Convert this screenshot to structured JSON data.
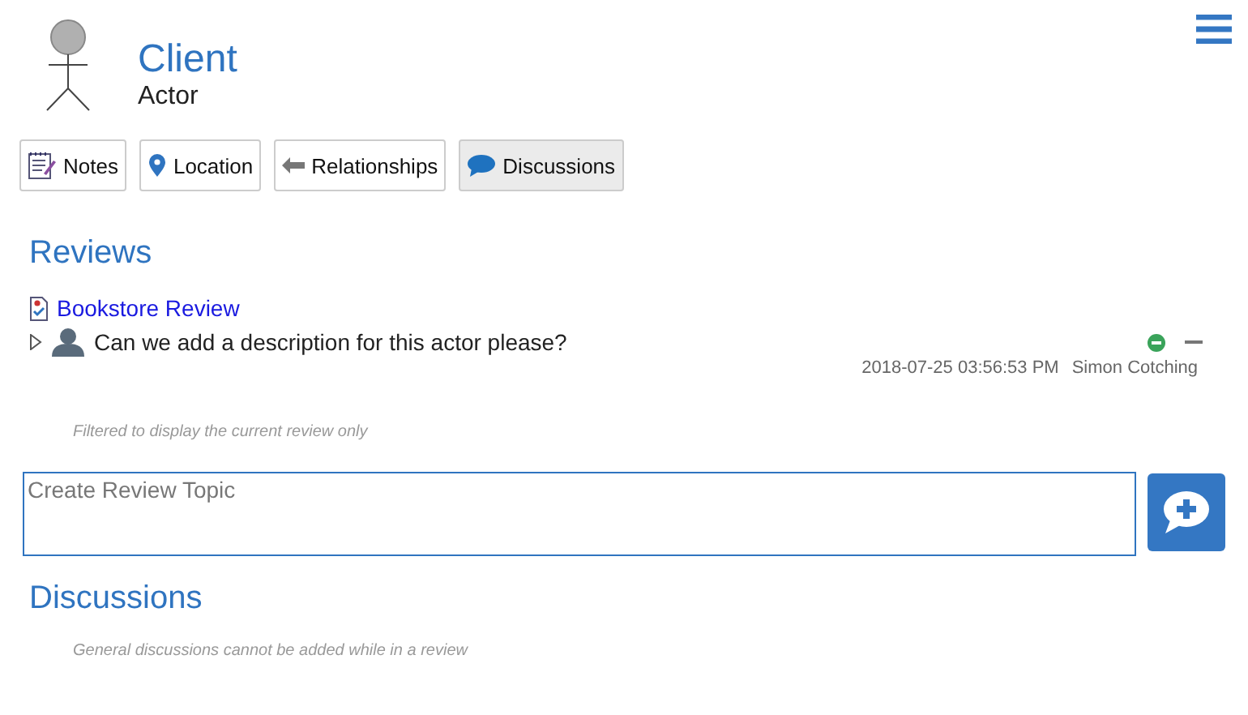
{
  "header": {
    "title": "Client",
    "subtitle": "Actor"
  },
  "tabs": [
    {
      "label": "Notes",
      "kind": "notes",
      "selected": false
    },
    {
      "label": "Location",
      "kind": "location",
      "selected": false
    },
    {
      "label": "Relationships",
      "kind": "relationships",
      "selected": false
    },
    {
      "label": "Discussions",
      "kind": "discussions",
      "selected": true
    }
  ],
  "reviews": {
    "heading": "Reviews",
    "review_link": "Bookstore Review",
    "topics": [
      {
        "text": "Can we add a description for this actor please?",
        "timestamp": "2018-07-25 03:56:53 PM",
        "author": "Simon Cotching",
        "expanded": false
      }
    ],
    "filter_note": "Filtered to display the current review only",
    "input": {
      "placeholder": "Create Review Topic"
    }
  },
  "discussions": {
    "heading": "Discussions",
    "note": "General discussions cannot be added while in a review"
  }
}
